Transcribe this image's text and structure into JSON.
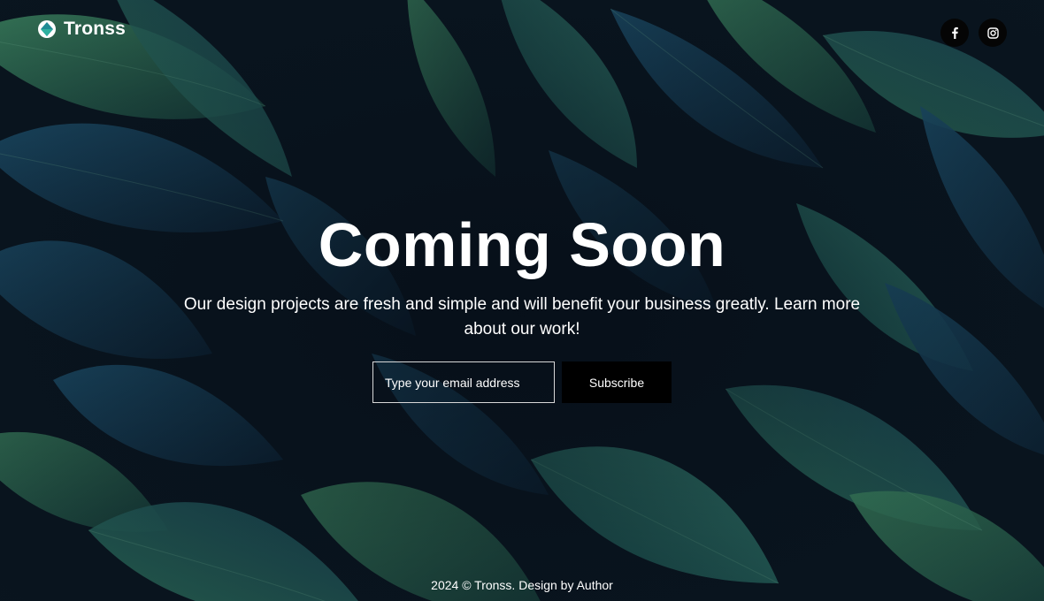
{
  "header": {
    "brand": "Tronss",
    "logo_icon": "globe-diamond-icon",
    "social": [
      {
        "name": "facebook",
        "icon": "facebook-icon"
      },
      {
        "name": "instagram",
        "icon": "instagram-icon"
      }
    ]
  },
  "hero": {
    "title": "Coming Soon",
    "subtitle": "Our design projects are fresh and simple and will benefit your business greatly. Learn more about our work!"
  },
  "form": {
    "email_placeholder": "Type your email address",
    "subscribe_label": "Subscribe"
  },
  "footer": {
    "text": "2024 © Tronss. Design by Author"
  },
  "colors": {
    "background": "#0a1a24",
    "leaf_dark": "#123a4a",
    "leaf_green": "#2f6b4f",
    "button": "#000000",
    "text": "#ffffff"
  }
}
